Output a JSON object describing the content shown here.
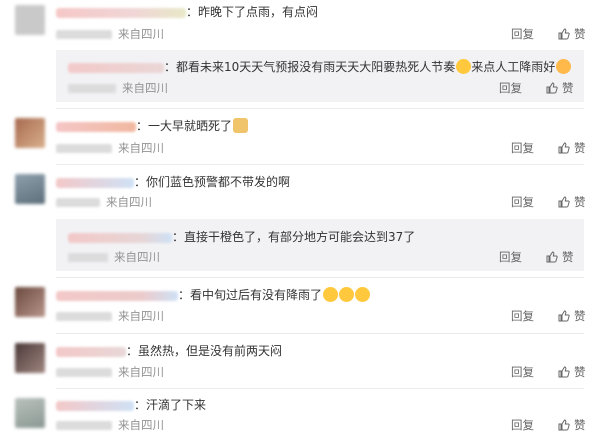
{
  "comments": [
    {
      "id": "c1",
      "text": "昨晚下了点雨，有点闷",
      "source": "来自四川",
      "reply": "回复",
      "like": "赞"
    },
    {
      "id": "c1r",
      "text": "都看未来10天天气预报没有雨天天大阳要热死人节奏",
      "emoji_mid": "crying-laughing-emoji",
      "text_after": "来点人工降雨好",
      "emoji_end": "yum-emoji",
      "source": "来自四川",
      "reply": "回复",
      "like": "赞"
    },
    {
      "id": "c2",
      "text": "一大早就晒死了",
      "emoji_end": "doge-emoji",
      "source": "来自四川",
      "reply": "回复",
      "like": "赞"
    },
    {
      "id": "c3",
      "text": "你们蓝色预警都不带发的啊",
      "source": "来自四川",
      "reply": "回复",
      "like": "赞"
    },
    {
      "id": "c3r",
      "text": "直接干橙色了，有部分地方可能会达到37了",
      "source": "来自四川",
      "reply": "回复",
      "like": "赞"
    },
    {
      "id": "c4",
      "text": "看中旬过后有没有降雨了",
      "emoji_end": "crying-laughing-emoji x3",
      "source": "来自四川",
      "reply": "回复",
      "like": "赞"
    },
    {
      "id": "c5",
      "text": "虽然热，但是没有前两天闷",
      "source": "来自四川",
      "reply": "回复",
      "like": "赞"
    },
    {
      "id": "c6",
      "text": "汗滴了下来",
      "source": "来自四川",
      "reply": "回复",
      "like": "赞"
    }
  ],
  "colors": {
    "text": "#333333",
    "meta": "#939393",
    "subBg": "#f2f2f5",
    "emoji": "#ffc83d"
  }
}
